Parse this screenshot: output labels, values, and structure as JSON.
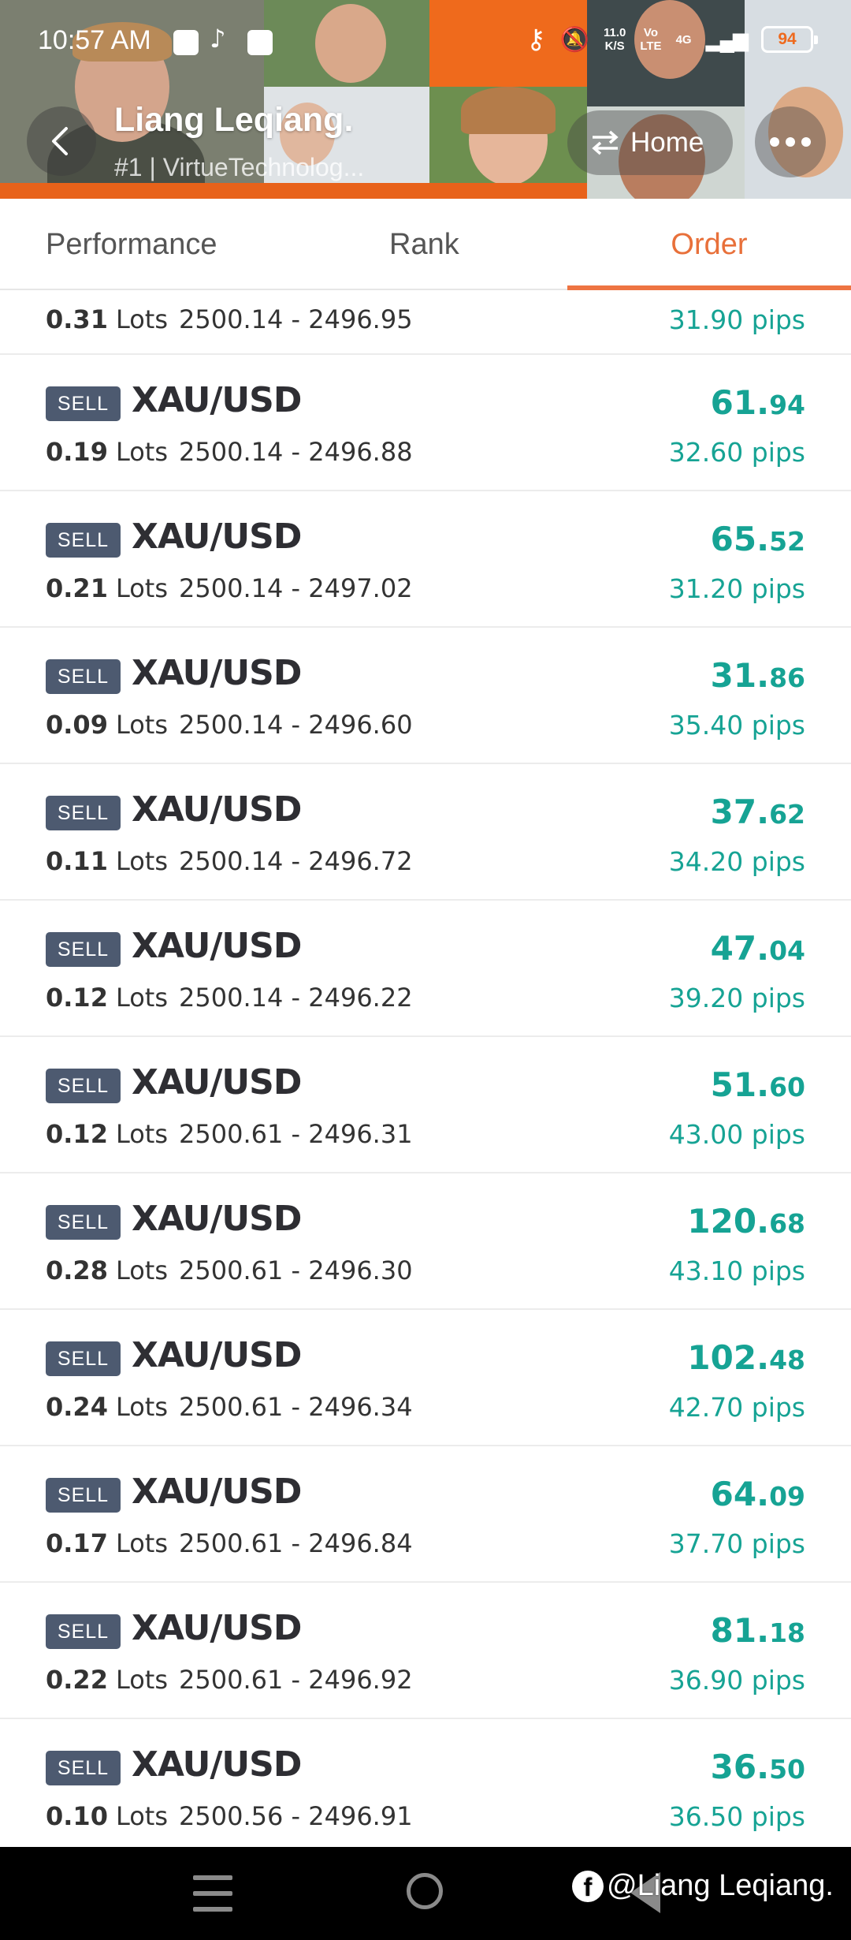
{
  "status_bar": {
    "time": "10:57 AM",
    "net_speed_top": "11.0",
    "net_speed_unit": "K/S",
    "volte_top": "Vo",
    "volte_bottom": "LTE",
    "network": "4G",
    "battery": "94",
    "battery_level": 0.94,
    "icons": [
      "vpn-icon",
      "tiktok-icon",
      "app-icon",
      "key-icon",
      "mute-icon",
      "signal-icon",
      "battery-icon"
    ]
  },
  "header": {
    "name": "Liang Leqiang.",
    "subtitle": "#1 | VirtueTechnolog...",
    "home_label": "Home",
    "accent_color": "#ee6a1e"
  },
  "tabs": [
    {
      "label": "Performance",
      "active": false
    },
    {
      "label": "Rank",
      "active": false
    },
    {
      "label": "Order",
      "active": true
    }
  ],
  "partial_order": {
    "lots": "0.31",
    "lots_unit": "Lots",
    "price_range": "2500.14 - 2496.95",
    "pips": "31.90 pips"
  },
  "orders": [
    {
      "side": "SELL",
      "symbol": "XAU/USD",
      "lots": "0.19",
      "lots_unit": "Lots",
      "price_range": "2500.14 - 2496.88",
      "profit_int": "61.",
      "profit_dec": "94",
      "pips": "32.60 pips"
    },
    {
      "side": "SELL",
      "symbol": "XAU/USD",
      "lots": "0.21",
      "lots_unit": "Lots",
      "price_range": "2500.14 - 2497.02",
      "profit_int": "65.",
      "profit_dec": "52",
      "pips": "31.20 pips"
    },
    {
      "side": "SELL",
      "symbol": "XAU/USD",
      "lots": "0.09",
      "lots_unit": "Lots",
      "price_range": "2500.14 - 2496.60",
      "profit_int": "31.",
      "profit_dec": "86",
      "pips": "35.40 pips"
    },
    {
      "side": "SELL",
      "symbol": "XAU/USD",
      "lots": "0.11",
      "lots_unit": "Lots",
      "price_range": "2500.14 - 2496.72",
      "profit_int": "37.",
      "profit_dec": "62",
      "pips": "34.20 pips"
    },
    {
      "side": "SELL",
      "symbol": "XAU/USD",
      "lots": "0.12",
      "lots_unit": "Lots",
      "price_range": "2500.14 - 2496.22",
      "profit_int": "47.",
      "profit_dec": "04",
      "pips": "39.20 pips"
    },
    {
      "side": "SELL",
      "symbol": "XAU/USD",
      "lots": "0.12",
      "lots_unit": "Lots",
      "price_range": "2500.61 - 2496.31",
      "profit_int": "51.",
      "profit_dec": "60",
      "pips": "43.00 pips"
    },
    {
      "side": "SELL",
      "symbol": "XAU/USD",
      "lots": "0.28",
      "lots_unit": "Lots",
      "price_range": "2500.61 - 2496.30",
      "profit_int": "120.",
      "profit_dec": "68",
      "pips": "43.10 pips"
    },
    {
      "side": "SELL",
      "symbol": "XAU/USD",
      "lots": "0.24",
      "lots_unit": "Lots",
      "price_range": "2500.61 - 2496.34",
      "profit_int": "102.",
      "profit_dec": "48",
      "pips": "42.70 pips"
    },
    {
      "side": "SELL",
      "symbol": "XAU/USD",
      "lots": "0.17",
      "lots_unit": "Lots",
      "price_range": "2500.61 - 2496.84",
      "profit_int": "64.",
      "profit_dec": "09",
      "pips": "37.70 pips"
    },
    {
      "side": "SELL",
      "symbol": "XAU/USD",
      "lots": "0.22",
      "lots_unit": "Lots",
      "price_range": "2500.61 - 2496.92",
      "profit_int": "81.",
      "profit_dec": "18",
      "pips": "36.90 pips"
    },
    {
      "side": "SELL",
      "symbol": "XAU/USD",
      "lots": "0.10",
      "lots_unit": "Lots",
      "price_range": "2500.56 - 2496.91",
      "profit_int": "36.",
      "profit_dec": "50",
      "pips": "36.50 pips"
    }
  ],
  "colors": {
    "profit": "#16a394",
    "sell_badge": "#4d5a70",
    "tab_active": "#e8703a"
  },
  "watermark": {
    "text": "@Liang Leqiang.",
    "icon": "facebook-icon"
  },
  "nav_bar": {
    "icons": [
      "menu-icon",
      "home-circle-icon",
      "back-triangle-icon"
    ]
  }
}
